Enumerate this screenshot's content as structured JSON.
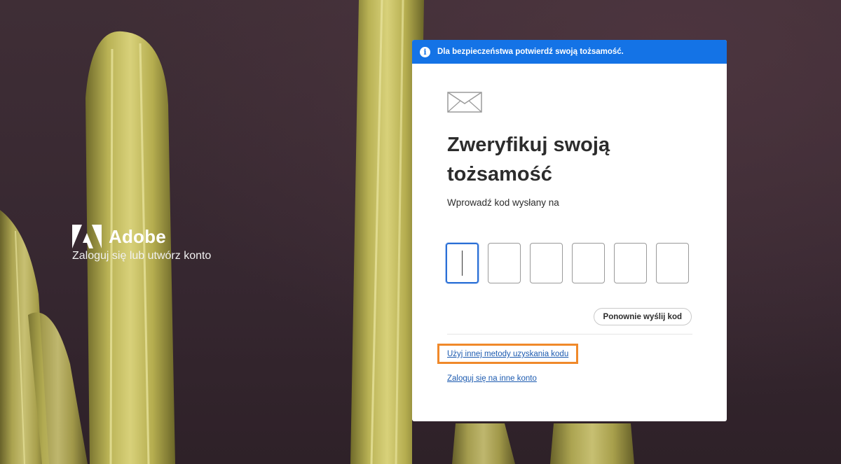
{
  "brand": {
    "name": "Adobe",
    "tagline": "Zaloguj się lub utwórz konto"
  },
  "banner": {
    "icon": "info-icon",
    "text": "Dla bezpieczeństwa potwierdź swoją tożsamość."
  },
  "card": {
    "icon": "mail-icon",
    "title_line1": "Zweryfikuj swoją",
    "title_line2": "tożsamość",
    "subtitle": "Wprowadź kod wysłany na"
  },
  "code_inputs": [
    "",
    "",
    "",
    "",
    "",
    ""
  ],
  "actions": {
    "resend_label": "Ponownie wyślij kod",
    "other_method_link": "Użyj innej metody uzyskania kodu",
    "other_account_link": "Zaloguj się na inne konto"
  },
  "colors": {
    "banner": "#1473e6",
    "link": "#1d5bb0",
    "highlight": "#f0892a"
  }
}
